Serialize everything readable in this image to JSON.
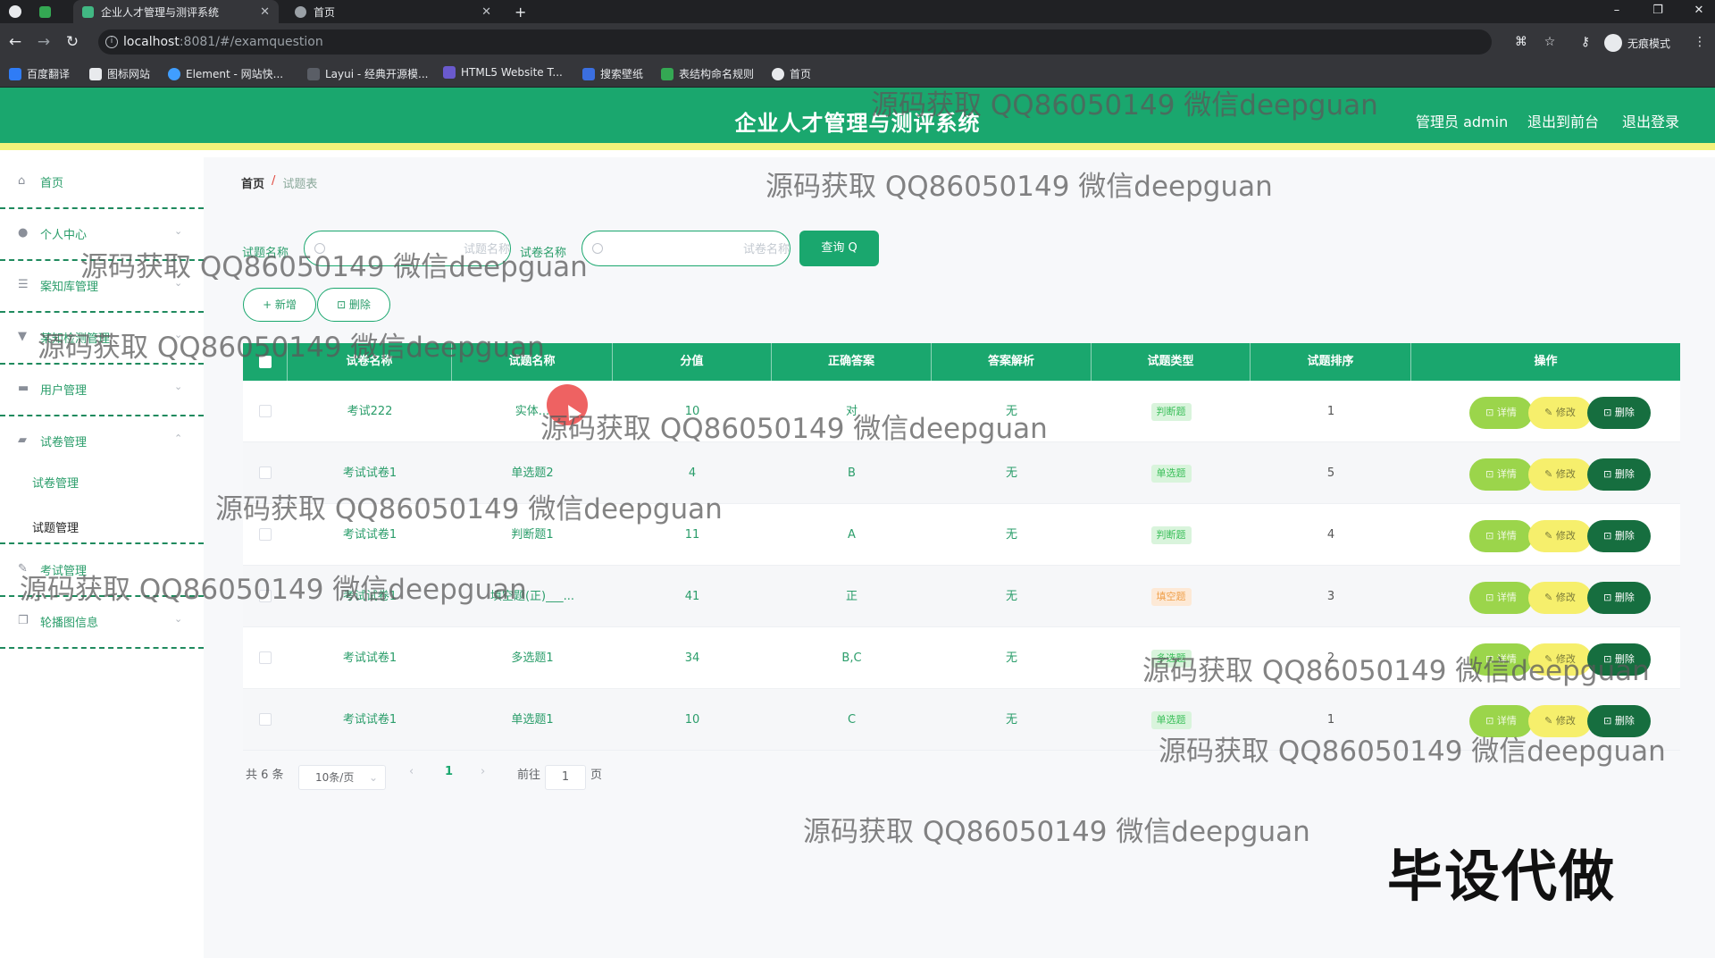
{
  "browser": {
    "tabs": [
      {
        "title": "企业人才管理与测评系统",
        "active": true
      },
      {
        "title": "首页",
        "active": false
      }
    ],
    "new_tab": "+",
    "url_host": "localhost",
    "url_path": ":8081/#/examquestion",
    "incognito_label": "无痕模式",
    "bookmarks": [
      "百度翻译",
      "图标网站",
      "Element - 网站快...",
      "Layui - 经典开源模...",
      "HTML5 Website T...",
      "搜索壁纸",
      "表结构命名规则",
      "首页"
    ]
  },
  "header": {
    "title": "企业人才管理与测评系统",
    "admin": "管理员 admin",
    "back_front": "退出到前台",
    "logout": "退出登录"
  },
  "sidebar": {
    "items": [
      {
        "label": "首页",
        "icon": "home-icon"
      },
      {
        "label": "个人中心",
        "icon": "user-icon"
      },
      {
        "label": "案知库管理",
        "icon": "sliders-icon"
      },
      {
        "label": "某知检测管理",
        "icon": "filter-icon"
      },
      {
        "label": "用户管理",
        "icon": "monitor-icon"
      },
      {
        "label": "试卷管理",
        "icon": "briefcase-icon"
      },
      {
        "label": "考试管理",
        "icon": "edit-icon"
      },
      {
        "label": "轮播图信息",
        "icon": "copy-icon"
      }
    ],
    "sub_items": [
      "试卷管理",
      "试题管理"
    ]
  },
  "breadcrumb": {
    "home": "首页",
    "sep": "/",
    "current": "试题表"
  },
  "search": {
    "label1": "试题名称",
    "placeholder1": "试题名称",
    "label2": "试卷名称",
    "placeholder2": "试卷名称",
    "query": "查询 Q"
  },
  "actions": {
    "add": "+ 新增",
    "delete": "⊡ 删除"
  },
  "table": {
    "headers": [
      "试卷名称",
      "试题名称",
      "分值",
      "正确答案",
      "答案解析",
      "试题类型",
      "试题排序",
      "操作"
    ],
    "rows": [
      {
        "paper": "考试222",
        "question": "实体...",
        "score": "10",
        "answer": "对",
        "analysis": "无",
        "type": "判断题",
        "sort": "1"
      },
      {
        "paper": "考试试卷1",
        "question": "单选题2",
        "score": "4",
        "answer": "B",
        "analysis": "无",
        "type": "单选题",
        "sort": "5"
      },
      {
        "paper": "考试试卷1",
        "question": "判断题1",
        "score": "11",
        "answer": "A",
        "analysis": "无",
        "type": "判断题",
        "sort": "4"
      },
      {
        "paper": "考试试卷1",
        "question": "填空题(正)___...",
        "score": "41",
        "answer": "正",
        "analysis": "无",
        "type": "填空题",
        "sort": "3"
      },
      {
        "paper": "考试试卷1",
        "question": "多选题1",
        "score": "34",
        "answer": "B,C",
        "analysis": "无",
        "type": "多选题",
        "sort": "2"
      },
      {
        "paper": "考试试卷1",
        "question": "单选题1",
        "score": "10",
        "answer": "C",
        "analysis": "无",
        "type": "单选题",
        "sort": "1"
      }
    ],
    "btn_detail": "⊡ 详情",
    "btn_edit": "✎ 修改",
    "btn_delete": "⊡ 删除"
  },
  "pagination": {
    "total": "共 6 条",
    "page_size": "10条/页",
    "prev": "‹",
    "current": "1",
    "next": "›",
    "goto": "前往",
    "goto_value": "1",
    "page_unit": "页"
  },
  "watermark": "源码获取 QQ86050149 微信deepguan",
  "promo": "毕设代做",
  "colors": {
    "primary": "#1aa76e",
    "accent_yellow": "#f3f27a",
    "detail": "#9bd54b",
    "edit": "#f6ef6c",
    "delete": "#166e3f"
  }
}
